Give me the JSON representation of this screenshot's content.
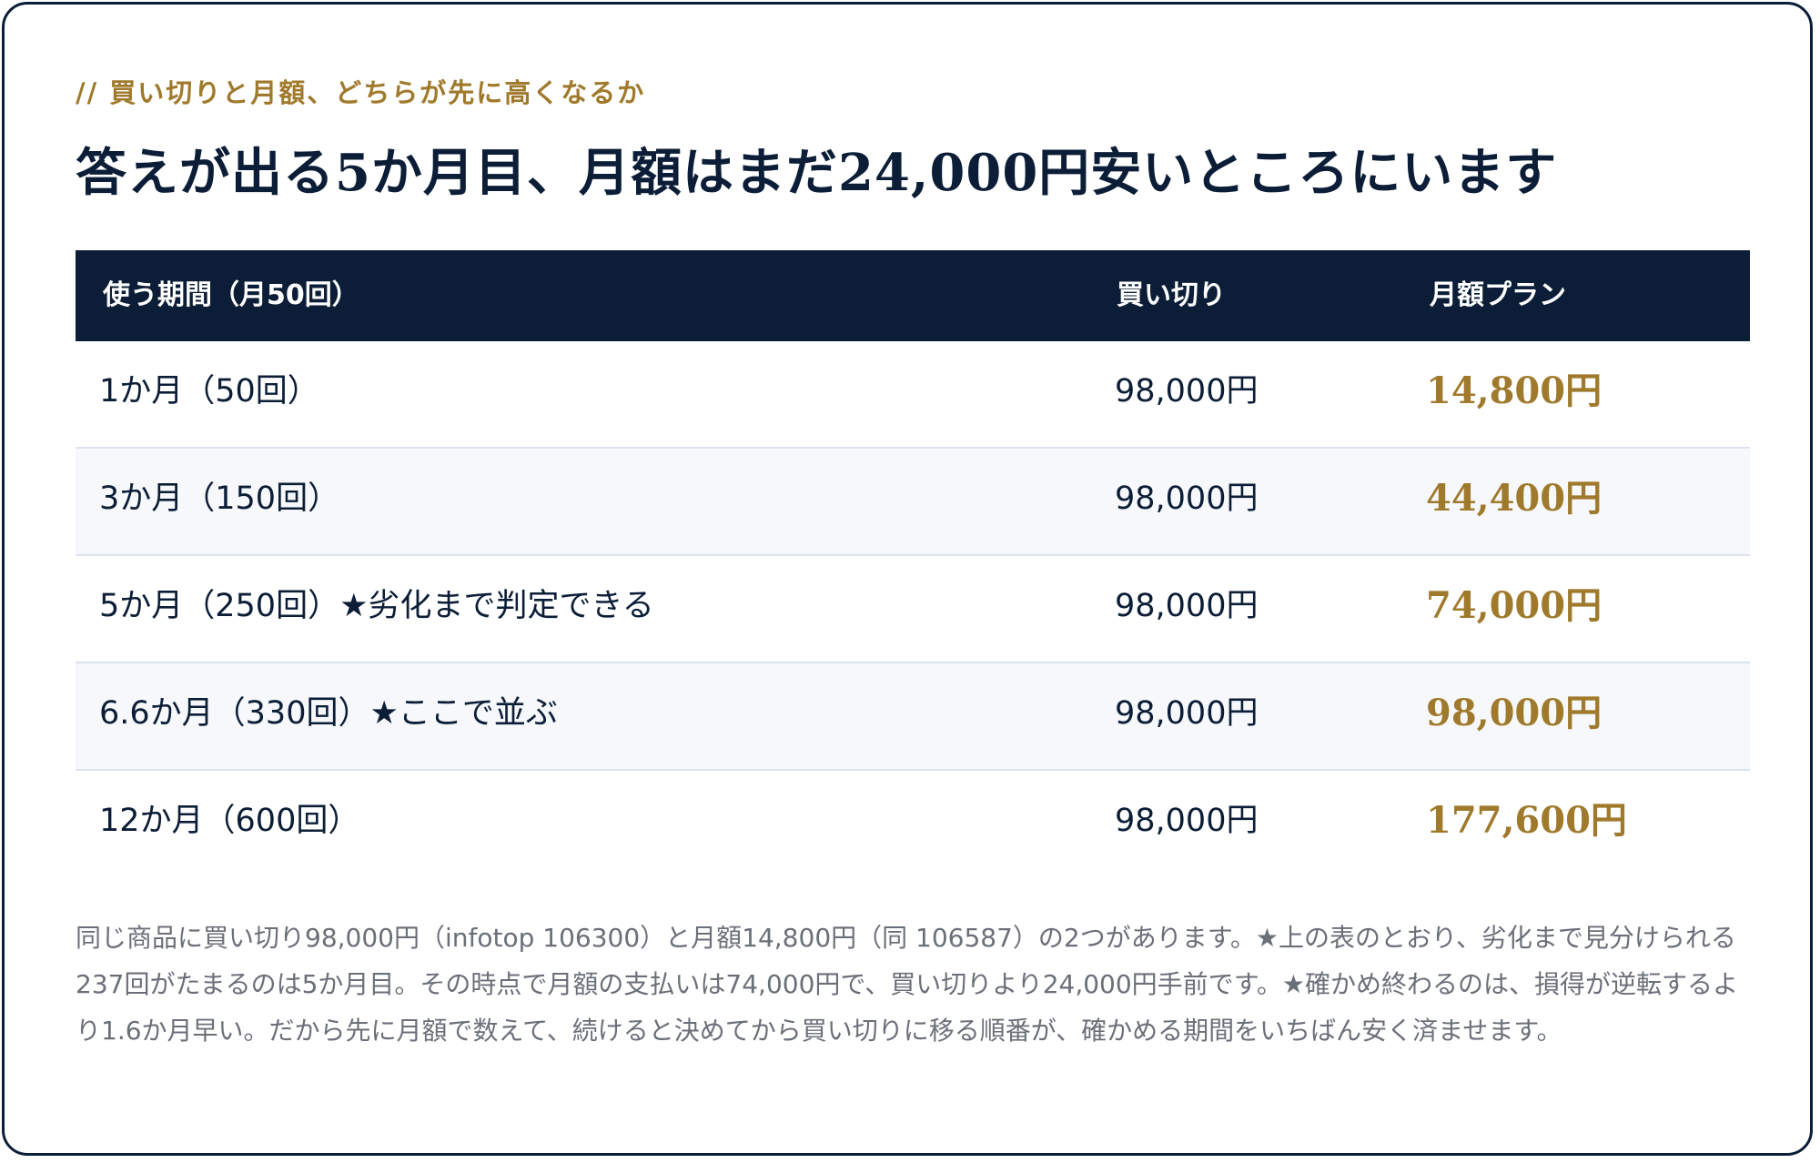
{
  "eyebrow": "// 買い切りと月額、どちらが先に高くなるか",
  "headline": "答えが出る5か月目、月額はまだ24,000円安いところにいます",
  "table": {
    "headers": {
      "period": "使う期間（月50回）",
      "buyout": "買い切り",
      "monthly": "月額プラン"
    },
    "rows": [
      {
        "period": "1か月（50回）",
        "buyout": "98,000円",
        "monthly": "14,800円"
      },
      {
        "period": "3か月（150回）",
        "buyout": "98,000円",
        "monthly": "44,400円"
      },
      {
        "period": "5か月（250回）★劣化まで判定できる",
        "buyout": "98,000円",
        "monthly": "74,000円"
      },
      {
        "period": "6.6か月（330回）★ここで並ぶ",
        "buyout": "98,000円",
        "monthly": "98,000円"
      },
      {
        "period": "12か月（600回）",
        "buyout": "98,000円",
        "monthly": "177,600円"
      }
    ]
  },
  "note": "同じ商品に買い切り98,000円（infotop 106300）と月額14,800円（同 106587）の2つがあります。★上の表のとおり、劣化まで見分けられる237回がたまるのは5か月目。その時点で月額の支払いは74,000円で、買い切りより24,000円手前です。★確かめ終わるのは、損得が逆転するより1.6か月早い。だから先に月額で数えて、続けると決めてから買い切りに移る順番が、確かめる期間をいちばん安く済ませます。",
  "colors": {
    "navy": "#0c1e37",
    "gold": "#a07a2c",
    "row_alt": "#f6f8fb",
    "note_text": "#6b6f78"
  }
}
